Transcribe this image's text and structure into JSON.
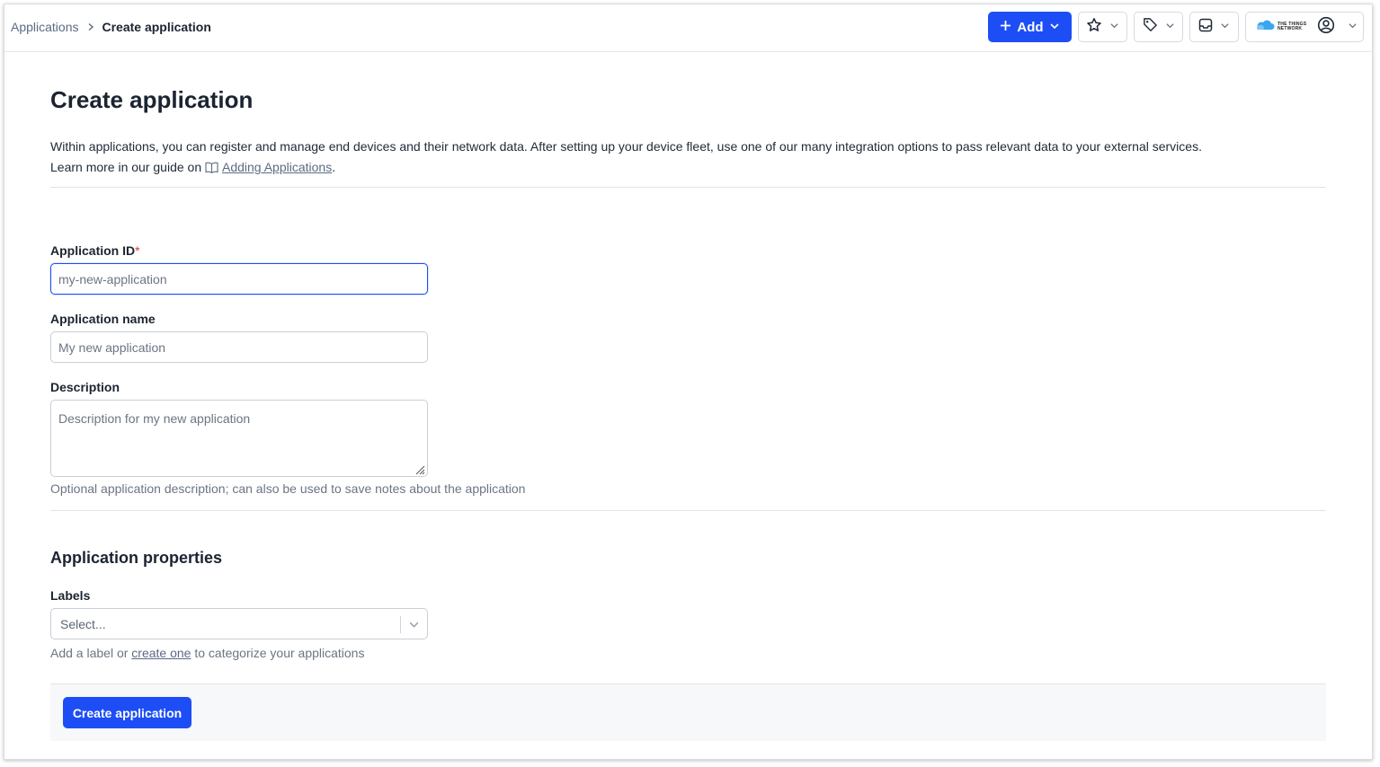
{
  "breadcrumb": {
    "parent": "Applications",
    "current": "Create application"
  },
  "header": {
    "add_label": "Add",
    "brand_line1": "THE THINGS",
    "brand_line2": "NETWORK"
  },
  "page": {
    "title": "Create application",
    "intro_line1": "Within applications, you can register and manage end devices and their network data. After setting up your device fleet, use one of our many integration options to pass relevant data to your external services.",
    "intro_line2_prefix": "Learn more in our guide on ",
    "guide_link": "Adding Applications",
    "intro_line2_suffix": "."
  },
  "form": {
    "app_id": {
      "label": "Application ID",
      "required_mark": "*",
      "placeholder": "my-new-application",
      "value": ""
    },
    "app_name": {
      "label": "Application name",
      "placeholder": "My new application",
      "value": ""
    },
    "description": {
      "label": "Description",
      "placeholder": "Description for my new application",
      "hint": "Optional application description; can also be used to save notes about the application"
    },
    "properties": {
      "title": "Application properties",
      "labels_label": "Labels",
      "labels_placeholder": "Select...",
      "hint_prefix": "Add a label or ",
      "hint_link": "create one",
      "hint_suffix": " to categorize your applications"
    },
    "submit_label": "Create application"
  },
  "colors": {
    "primary": "#1d4ef5",
    "required": "#e0342f",
    "muted_text": "#6b7583"
  }
}
